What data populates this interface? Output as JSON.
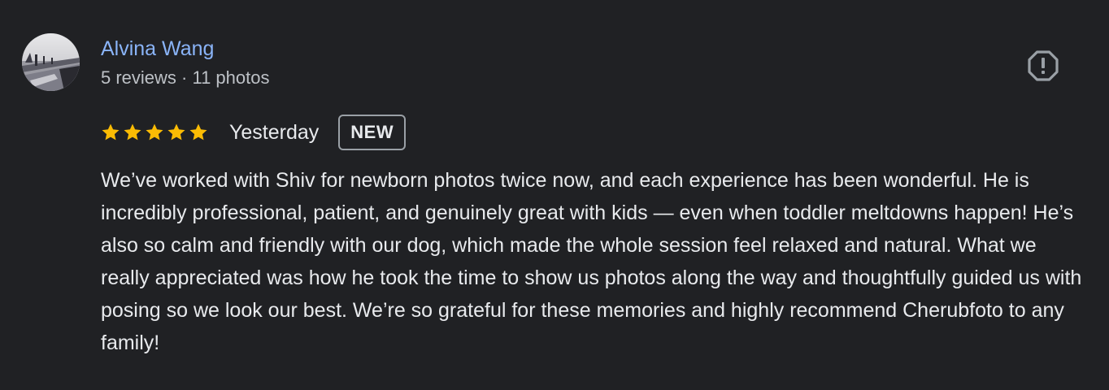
{
  "review": {
    "author_name": "Alvina Wang",
    "author_meta": "5 reviews · 11 photos",
    "avatar": "profile-photo",
    "rating": 5,
    "rating_max": 5,
    "date": "Yesterday",
    "badge": "NEW",
    "report_icon": "report-flag-icon",
    "text": "We’ve worked with Shiv for newborn photos twice now, and each experience has been wonderful. He is incredibly professional, patient, and genuinely great with kids — even when toddler meltdowns happen! He’s also so calm and friendly with our dog, which made the whole session feel relaxed and natural. What we really appreciated was how he took the time to show us photos along the way and thoughtfully guided us with posing so we look our best. We’re so grateful for these memories and highly recommend Cherubfoto to any family!"
  },
  "colors": {
    "background": "#202124",
    "author_link": "#8ab4f8",
    "star": "#fbbc04",
    "text_primary": "#e8eaed",
    "text_secondary": "#bdc1c6"
  }
}
